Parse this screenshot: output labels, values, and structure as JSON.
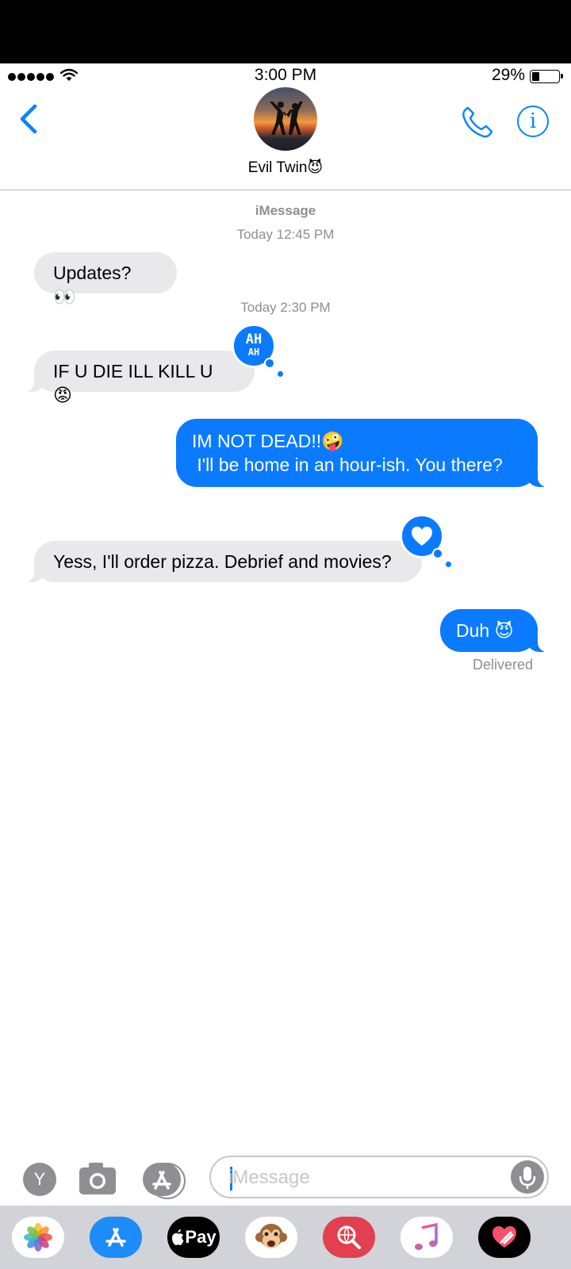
{
  "status_bar": {
    "time": "3:00 PM",
    "battery_percent": "29%",
    "battery_level": 0.29
  },
  "nav": {
    "contact_name": "Evil Twin😈",
    "icons": [
      "back-chevron-icon",
      "phone-icon",
      "info-icon"
    ]
  },
  "conversation": {
    "service_label": "iMessage",
    "timestamp_1": "Today 12:45 PM",
    "timestamp_2": "Today 2:30 PM",
    "messages": [
      {
        "direction": "incoming",
        "text": "Updates? 👀"
      },
      {
        "direction": "incoming",
        "text": "IF U DIE ILL KILL U 😡",
        "tapback": "haha"
      },
      {
        "direction": "outgoing",
        "line1": "IM NOT DEAD!!🤪",
        "line2": " I'll be home in an hour-ish. You there?"
      },
      {
        "direction": "incoming",
        "text": "Yess, I'll order pizza. Debrief and movies?",
        "tapback": "heart"
      },
      {
        "direction": "outgoing",
        "text": "Duh 😈"
      }
    ],
    "haha_line1": "AH",
    "haha_line2": "AH",
    "delivered_label": "Delivered"
  },
  "composer": {
    "avatar_letter": "Y",
    "placeholder": "iMessage",
    "icons": [
      "camera-icon",
      "app-store-icon",
      "microphone-icon"
    ]
  },
  "app_tray": {
    "apple_pay_label": "Pay",
    "items": [
      "photos-app",
      "app-store-app",
      "apple-pay-app",
      "animoji-app",
      "web-search-app",
      "music-app",
      "digital-touch-app"
    ]
  }
}
